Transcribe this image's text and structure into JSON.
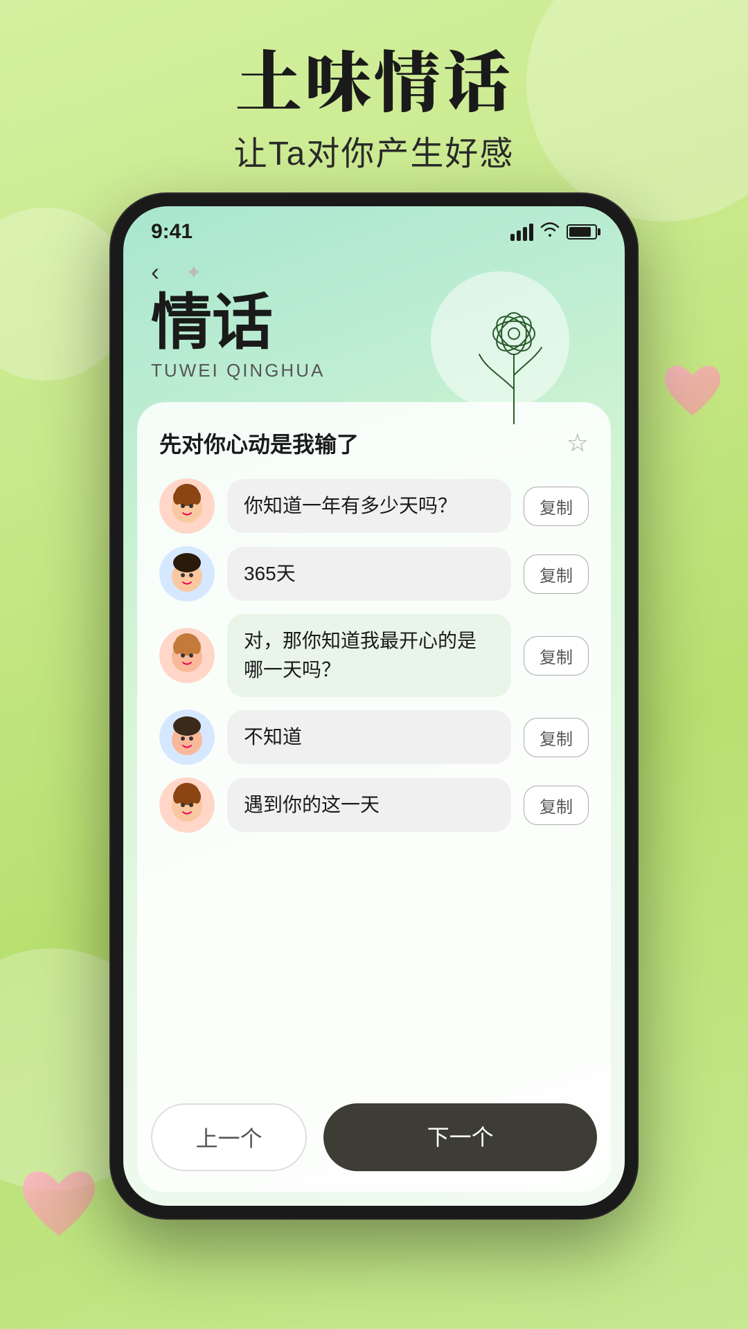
{
  "page": {
    "background": "#c8e870"
  },
  "top": {
    "main_title": "土味情话",
    "subtitle": "让Ta对你产生好感"
  },
  "status_bar": {
    "time": "9:41",
    "signal": "signal",
    "wifi": "wifi",
    "battery": "battery"
  },
  "app_header": {
    "back": "‹",
    "title_cn": "情话",
    "title_en": "TUWEI QINGHUA"
  },
  "card": {
    "title": "先对你心动是我输了",
    "star": "☆",
    "items": [
      {
        "id": 1,
        "avatar_type": "girl",
        "avatar_emoji": "👩",
        "text": "你知道一年有多少天吗？",
        "copy_label": "复制",
        "highlighted": false
      },
      {
        "id": 2,
        "avatar_type": "boy",
        "avatar_emoji": "👦",
        "text": "365天",
        "copy_label": "复制",
        "highlighted": false
      },
      {
        "id": 3,
        "avatar_type": "girl",
        "avatar_emoji": "👩",
        "text": "对，那你知道我最开心的是哪一天吗？",
        "copy_label": "复制",
        "highlighted": true
      },
      {
        "id": 4,
        "avatar_type": "boy",
        "avatar_emoji": "👦",
        "text": "不知道",
        "copy_label": "复制",
        "highlighted": false
      },
      {
        "id": 5,
        "avatar_type": "girl",
        "avatar_emoji": "👩",
        "text": "遇到你的这一天",
        "copy_label": "复制",
        "highlighted": false
      }
    ]
  },
  "navigation": {
    "prev_label": "上一个",
    "next_label": "下一个"
  }
}
